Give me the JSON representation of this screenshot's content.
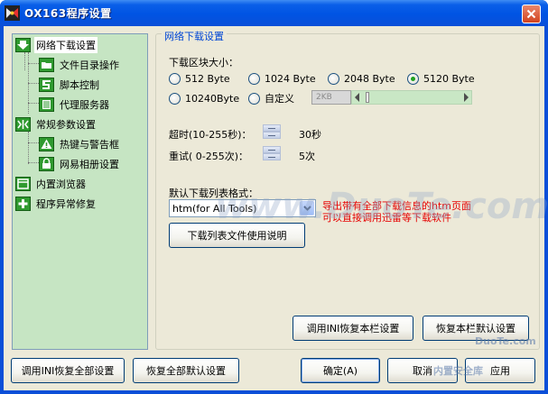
{
  "window": {
    "title": "OX163程序设置",
    "close_symbol": "✕"
  },
  "sidebar": {
    "items": [
      {
        "label": "网络下载设置",
        "icon": "download-arrow-icon"
      },
      {
        "label": "文件目录操作",
        "icon": "folder-icon"
      },
      {
        "label": "脚本控制",
        "icon": "script-icon"
      },
      {
        "label": "代理服务器",
        "icon": "server-icon"
      },
      {
        "label": "常规参数设置",
        "icon": "settings-icon"
      },
      {
        "label": "热键与警告框",
        "icon": "warning-icon"
      },
      {
        "label": "网易相册设置",
        "icon": "lock-icon"
      },
      {
        "label": "内置浏览器",
        "icon": "browser-icon"
      },
      {
        "label": "程序异常修复",
        "icon": "plus-icon"
      }
    ]
  },
  "panel": {
    "group_title": "网络下载设置",
    "block_size_label": "下载区块大小：",
    "block_options": [
      "512  Byte",
      "1024 Byte",
      "2048 Byte",
      "5120 Byte",
      "10240Byte",
      "自定义"
    ],
    "block_selected": "5120 Byte",
    "custom_value": "2KB",
    "slider_level": 0.03,
    "timeout_label": "超时(10-255秒)：",
    "timeout_value": "30秒",
    "retry_label": "重试( 0-255次)：",
    "retry_value": "5次",
    "list_format_label": "默认下载列表格式：",
    "list_format_value": "htm(for All Tools)",
    "note_line1": "导出带有全部下载信息的htm页面",
    "note_line2": "可以直接调用迅雷等下载软件",
    "help_button": "下载列表文件使用说明",
    "restore_ini_section": "调用INI恢复本栏设置",
    "restore_default_section": "恢复本栏默认设置"
  },
  "footer": {
    "restore_ini_all": "调用INI恢复全部设置",
    "restore_default_all": "恢复全部默认设置",
    "ok": "确定(A)",
    "cancel": "取消",
    "apply": "应用"
  },
  "watermarks": {
    "center": "www.DuoTe.com",
    "corner_top": "DuoTe.com",
    "corner_bottom": "内置安全库"
  },
  "colors": {
    "title_bar": "#0054e3",
    "tree_background": "#c6e5c3",
    "group_title": "#0046d5",
    "note_text": "#e60000",
    "radio_dot": "#21a121"
  }
}
